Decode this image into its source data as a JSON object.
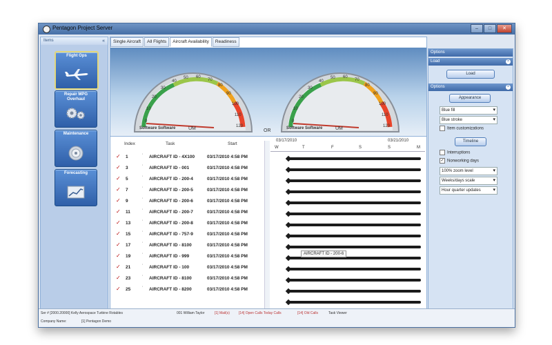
{
  "window": {
    "title": "Pentagon Project Server",
    "controls": [
      "–",
      "□",
      "✕"
    ]
  },
  "left_panel": {
    "title": "Items",
    "pin": "«",
    "items": [
      {
        "label": "Flight Ops",
        "icon": "airplane-icon"
      },
      {
        "label": "Repair MPG Overhaul",
        "icon": "gears-icon"
      },
      {
        "label": "Maintenance",
        "icon": "disc-icon"
      },
      {
        "label": "Forecasting",
        "icon": "chart-icon"
      }
    ]
  },
  "tabs": [
    "Single Aircraft",
    "All Flights",
    "Aircraft Availability",
    "Readiness"
  ],
  "active_tab": 2,
  "gauges": {
    "brand": "Software Software",
    "um_label": "UM",
    "center": "OR",
    "g1": {
      "ticks": [
        "0",
        "10",
        "20",
        "30",
        "40",
        "50",
        "60",
        "70",
        "80",
        "90",
        "100",
        "110",
        "120"
      ]
    },
    "g2": {
      "ticks": [
        "0",
        "10",
        "20",
        "30",
        "40",
        "50",
        "60",
        "70",
        "80",
        "90",
        "100",
        "110",
        "120"
      ]
    }
  },
  "grid": {
    "headers": {
      "index": "Index",
      "task": "Task",
      "start": "Start"
    },
    "rows": [
      {
        "index": "1",
        "task": "AIRCRAFT ID - 4X100",
        "start": "03/17/2010 4:58 PM"
      },
      {
        "index": "3",
        "task": "AIRCRAFT ID - 001",
        "start": "03/17/2010 4:58 PM"
      },
      {
        "index": "5",
        "task": "AIRCRAFT ID - 200-4",
        "start": "03/17/2010 4:58 PM"
      },
      {
        "index": "7",
        "task": "AIRCRAFT ID - 200-5",
        "start": "03/17/2010 4:58 PM"
      },
      {
        "index": "9",
        "task": "AIRCRAFT ID - 200-6",
        "start": "03/17/2010 4:58 PM"
      },
      {
        "index": "11",
        "task": "AIRCRAFT ID - 200-7",
        "start": "03/17/2010 4:58 PM"
      },
      {
        "index": "13",
        "task": "AIRCRAFT ID - 200-8",
        "start": "03/17/2010 4:58 PM"
      },
      {
        "index": "15",
        "task": "AIRCRAFT ID - 757-9",
        "start": "03/17/2010 4:58 PM"
      },
      {
        "index": "17",
        "task": "AIRCRAFT ID - 8100",
        "start": "03/17/2010 4:58 PM"
      },
      {
        "index": "19",
        "task": "AIRCRAFT ID - 999",
        "start": "03/17/2010 4:58 PM"
      },
      {
        "index": "21",
        "task": "AIRCRAFT ID - 100",
        "start": "03/17/2010 4:58 PM"
      },
      {
        "index": "23",
        "task": "AIRCRAFT ID - 8100",
        "start": "03/17/2010 4:58 PM"
      },
      {
        "index": "25",
        "task": "AIRCRAFT ID - 8200",
        "start": "03/17/2010 4:58 PM"
      }
    ]
  },
  "gantt": {
    "date1": "03/17/2010",
    "date2": "03/21/2010",
    "days": [
      "W",
      "T",
      "F",
      "S",
      "S",
      "M"
    ],
    "tooltip": "AIRCRAFT ID - 200-6"
  },
  "options": {
    "title": "Options",
    "load_section": "Load",
    "load_button": "Load",
    "options_section": "Options",
    "appearance_button": "Appearance",
    "fill": "Blue fill",
    "stroke": "Blue stroke",
    "item_customizations": "Item customizations",
    "timeline_button": "Timeline",
    "interruptions": "Interruptions",
    "nonworking_days": "Nonworking days",
    "zoom": "100% zoom level",
    "scale": "Weeks/days scale",
    "updates": "Hour quarter updates"
  },
  "status": {
    "ser": "Ser # [2000.20000] Kelly Aerospace Turbine Rotables",
    "user": "001 William Taylor",
    "s1": "[1] Mail(s)",
    "s2": "[14] Open Calls Today Calls",
    "s3": "[14] Old Calls",
    "s4": "Task Viewer",
    "company_label": "Company Name:",
    "company": "[1]   Pentagon Demo"
  },
  "colors": {
    "accent": "#3f6aa8",
    "gauge_red": "#e8442a",
    "gauge_green": "#3aa14b"
  }
}
